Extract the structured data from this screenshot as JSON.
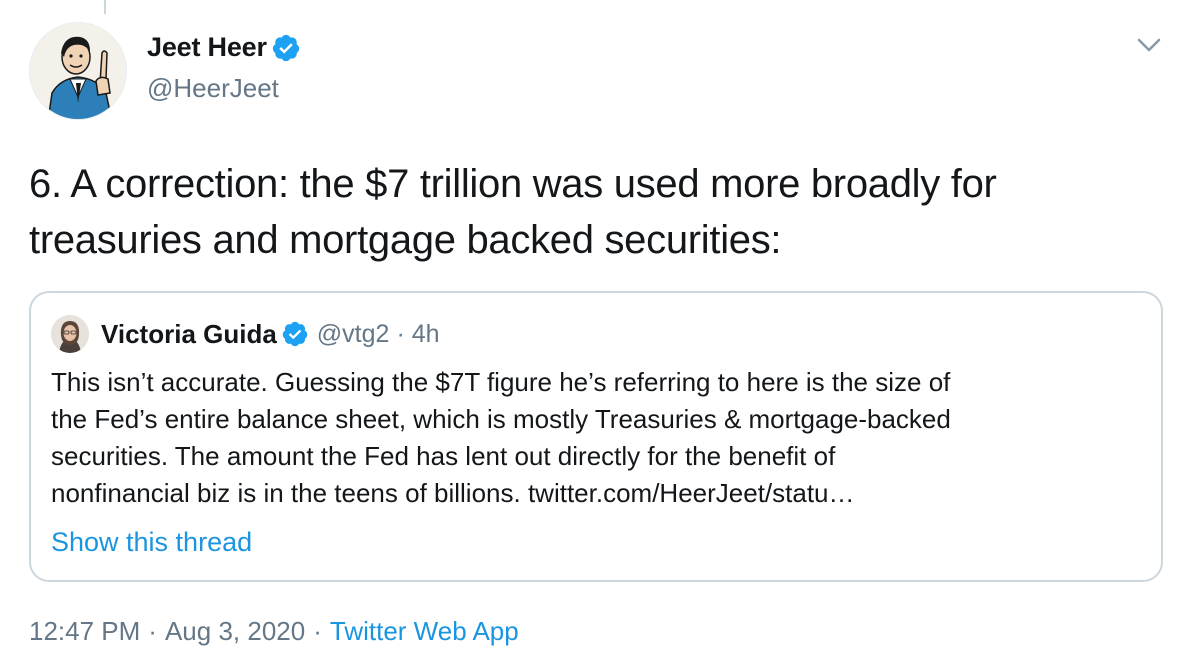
{
  "tweet": {
    "author": {
      "name": "Jeet Heer",
      "handle": "@HeerJeet",
      "verified": true
    },
    "text": "6. A correction: the $7 trillion was used more broadly for treasuries and mortgage backed securities:",
    "quoted": {
      "name": "Victoria Guida",
      "handle": "@vtg2",
      "separator": "·",
      "time": "4h",
      "verified": true,
      "text": "This isn’t accurate. Guessing the $7T figure he’s referring to here is the size of\nthe Fed’s entire balance sheet, which is mostly Treasuries & mortgage-backed\nsecurities. The amount the Fed has lent out directly for the benefit of\nnonfinancial biz is in the teens of billions. twitter.com/HeerJeet/statu…",
      "show_thread": "Show this thread"
    },
    "meta": {
      "time": "12:47 PM",
      "separator": "·",
      "date": "Aug 3, 2020",
      "source": "Twitter Web App"
    }
  },
  "colors": {
    "link": "#1b95e0",
    "verified": "#1da1f2",
    "secondary": "#657786",
    "border": "#ccd6dd"
  },
  "icons": {
    "verified": "verified-badge-icon",
    "menu": "chevron-down-icon"
  }
}
